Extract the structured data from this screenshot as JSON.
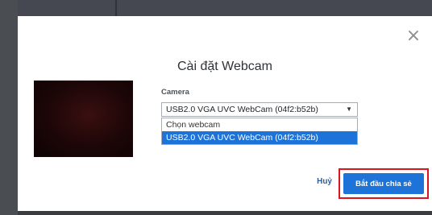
{
  "modal": {
    "title": "Cài đặt Webcam",
    "close_icon": "close-icon",
    "camera_label": "Camera",
    "select": {
      "value": "USB2.0 VGA UVC WebCam (04f2:b52b)",
      "arrow_icon": "chevron-down-icon",
      "options": [
        "Chọn webcam",
        "USB2.0 VGA UVC WebCam (04f2:b52b)"
      ],
      "selected_index": 1
    },
    "cancel_label": "Huỷ",
    "start_label": "Bắt đầu chia sẻ",
    "accent_color": "#1e73d8",
    "highlight_color": "#d9161d"
  }
}
